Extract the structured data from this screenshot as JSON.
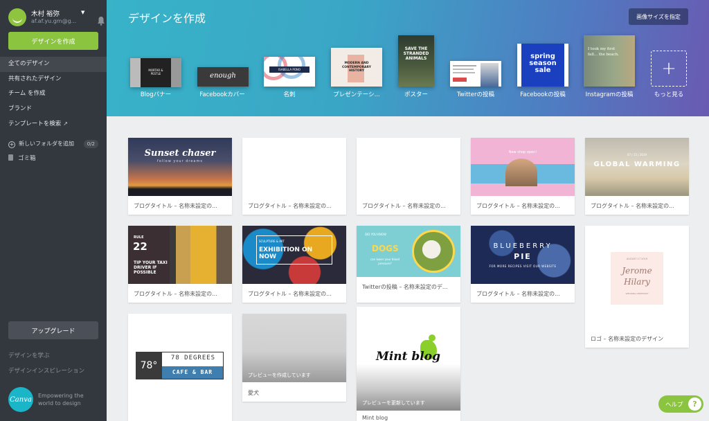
{
  "colors": {
    "sidebar": "#33383f",
    "accent": "#8bc43f",
    "header_start": "#38b3c8",
    "header_end": "#6a5ab2"
  },
  "sidebar": {
    "user_name": "木村 裕弥",
    "user_email": "af.af.yu.gm@g...",
    "create_label": "デザインを作成",
    "nav": [
      {
        "label": "全てのデザイン"
      },
      {
        "label": "共有されたデザイン"
      },
      {
        "label": "チーム を作成"
      },
      {
        "label": "ブランド"
      },
      {
        "label": "テンプレートを検索"
      }
    ],
    "new_folder": "新しいフォルダを追加",
    "folder_count": "0/2",
    "trash": "ゴミ箱",
    "upgrade": "アップグレード",
    "learn": "デザインを学ぶ",
    "inspiration": "デザインインスピレーション",
    "logo_text": "Canva",
    "tagline": "Empowering the world to design"
  },
  "header": {
    "title": "デザインを作成",
    "custom_size": "画像サイズを指定",
    "templates": [
      {
        "label": "Blogバナー",
        "thumb_text": "MORTAR & PESTLE"
      },
      {
        "label": "Facebookカバー",
        "thumb_text": "enough"
      },
      {
        "label": "名刺",
        "thumb_text": "ISABELLA PONO"
      },
      {
        "label": "プレゼンテーシ...",
        "thumb_text": "MODERN AND CONTEMPORARY HISTORY"
      },
      {
        "label": "ポスター",
        "thumb_text": "SAVE THE STRANDED ANIMALS"
      },
      {
        "label": "Twitterの投稿",
        "thumb_text": ""
      },
      {
        "label": "Facebookの投稿",
        "thumb_text": "spring season sale"
      },
      {
        "label": "Instagramの投稿",
        "thumb_text": "I took my first fall... the beach."
      }
    ],
    "more_label": "もっと見る",
    "more_icon": "+"
  },
  "cards": [
    {
      "caption": "ブログタイトル – 名称未設定の...",
      "title": "Sunset chaser",
      "sub": "follow your dreams"
    },
    {
      "caption": "ブログタイトル – 名称未設定の..."
    },
    {
      "caption": "ブログタイトル – 名称未設定の..."
    },
    {
      "caption": "ブログタイトル – 名称未設定の...",
      "title": "New shop open!"
    },
    {
      "caption": "ブログタイトル – 名称未設定の...",
      "title": "GLOBAL WARMING",
      "date": "07 | 15 | 2019"
    },
    {
      "caption": "ブログタイトル – 名称未設定の...",
      "rule": "RULE",
      "num": "22",
      "text": "TIP YOUR TAXI DRIVER IF POSSIBLE"
    },
    {
      "caption": "ブログタイトル – 名称未設定の...",
      "small": "SCULPTURE & ART",
      "title": "EXHIBITION ON NOW"
    },
    {
      "caption": "Twitterの投稿 – 名称未設定のデ...",
      "small": "DID YOU KNOW",
      "title": "DOGS",
      "sub": "can lower your blood pressure?"
    },
    {
      "caption": "ブログタイトル – 名称未設定の...",
      "title": "BLUEBERRY",
      "title2": "PIE",
      "sub": "FOR MORE RECIPES VISIT OUR WEBSITE"
    },
    {
      "caption": "ロゴ – 名称未設定のデザイン",
      "small": "AUGUST 17 2019",
      "title": "Jerome",
      "title2": "Hilary",
      "sub": "WEDDING CEREMONY"
    },
    {
      "caption": "",
      "deg": "78°",
      "title": "78 DEGREES",
      "sub": "CAFE & BAR"
    },
    {
      "caption": "愛犬",
      "note": "プレビューを作成しています"
    },
    {
      "caption": "Mint blog",
      "title": "Mint blog",
      "note": "プレビューを更新しています"
    }
  ],
  "help": {
    "label": "ヘルプ",
    "icon": "?"
  }
}
